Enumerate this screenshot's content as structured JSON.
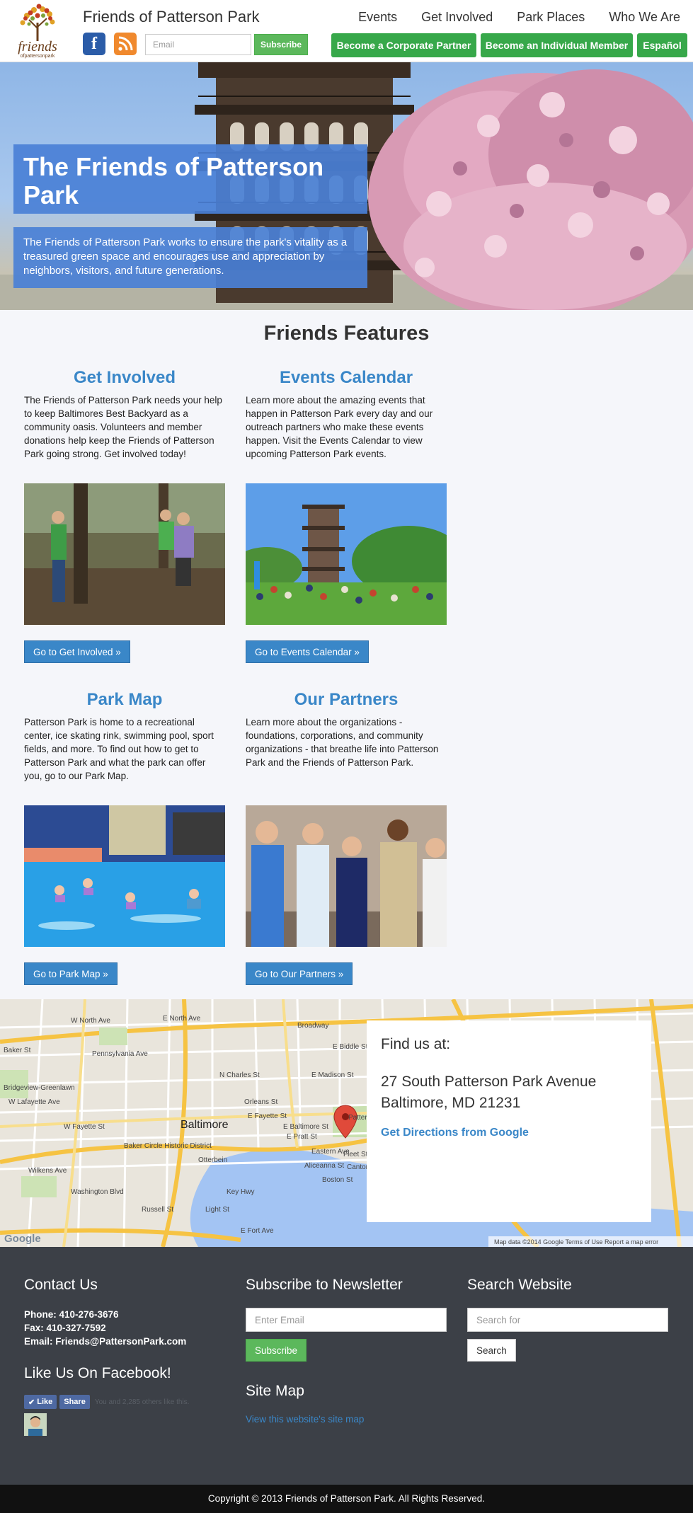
{
  "header": {
    "site_title": "Friends of Patterson Park",
    "logo": {
      "word": "friends",
      "sub": "ofpattersonpark"
    },
    "nav": [
      "Events",
      "Get Involved",
      "Park Places",
      "Who We Are"
    ],
    "email_placeholder": "Email",
    "subscribe_label": "Subscribe",
    "buttons": {
      "corporate": "Become a Corporate Partner",
      "individual": "Become an Individual Member",
      "espanol": "Español"
    },
    "facebook_glyph": "f",
    "accent": "#37a84a"
  },
  "hero": {
    "title": "The Friends of Patterson Park",
    "description": "The Friends of Patterson Park works to ensure the park's vitality as a treasured green space and encourages use and appreciation by neighbors, visitors, and future generations."
  },
  "features": {
    "heading": "Friends Features",
    "items": [
      {
        "title": "Get Involved",
        "text": "The Friends of Patterson Park needs your help to keep Baltimores Best Backyard as a community oasis. Volunteers and member donations help keep the Friends of Patterson Park going strong. Get involved today!",
        "button": "Go to Get Involved »"
      },
      {
        "title": "Events Calendar",
        "text": "Learn more about the amazing events that happen in Patterson Park every day and our outreach partners who make these events happen. Visit the Events Calendar to view upcoming Patterson Park events.",
        "button": "Go to Events Calendar »"
      },
      {
        "title": "Park Map",
        "text": "Patterson Park is home to a recreational center, ice skating rink, swimming pool, sport fields, and more. To find out how to get to Patterson Park and what the park can offer you, go to our Park Map.",
        "button": "Go to Park Map »"
      },
      {
        "title": "Our Partners",
        "text": "Learn more about the organizations - foundations, corporations, and community organizations - that breathe life into Patterson Park and the Friends of Patterson Park.",
        "button": "Go to Our Partners »"
      }
    ]
  },
  "map": {
    "find_label": "Find us at:",
    "address_line1": "27 South Patterson Park Avenue",
    "address_line2": "Baltimore, MD 21231",
    "directions": "Get Directions from Google",
    "city_label": "Baltimore",
    "attribution": "Map data ©2014 Google   Terms of Use   Report a map error",
    "google_mark": "Google",
    "streets": [
      "W North Ave",
      "E North Ave",
      "Broadway",
      "E Biddle St",
      "E Madison St",
      "Orleans St",
      "E Fayette St",
      "E Baltimore St",
      "E Pratt St",
      "Eastern Ave",
      "Fleet St",
      "W Fayette St",
      "W Lafayette Ave",
      "Wilkens Ave",
      "Washington Blvd",
      "Baker St",
      "Bridgeview-Greenlawn",
      "Key Hwy",
      "E Fort Ave",
      "Boston St",
      "Aliceanna St",
      "Patterson Park",
      "Baker Circle Historic District",
      "Otterbein",
      "Canton",
      "Pennsylvania Ave",
      "N Charles St",
      "Light St",
      "Russell St"
    ]
  },
  "footer": {
    "contact_heading": "Contact Us",
    "phone": "Phone: 410-276-3676",
    "fax": "Fax: 410-327-7592",
    "email": "Email: Friends@PattersonPark.com",
    "facebook_heading": "Like Us On Facebook!",
    "like_label": "Like",
    "share_label": "Share",
    "like_text": "You and 2,285 others like this.",
    "newsletter_heading": "Subscribe to Newsletter",
    "newsletter_placeholder": "Enter Email",
    "newsletter_button": "Subscribe",
    "sitemap_heading": "Site Map",
    "sitemap_link": "View this website's site map",
    "search_heading": "Search Website",
    "search_placeholder": "Search for",
    "search_button": "Search",
    "copyright": "Copyright © 2013 Friends of Patterson Park. All Rights Reserved."
  }
}
